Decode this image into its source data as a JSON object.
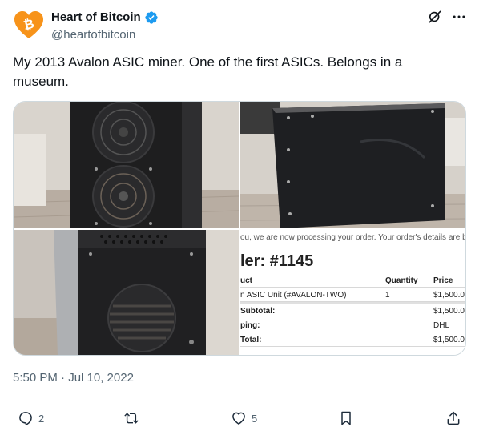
{
  "author": {
    "name": "Heart of Bitcoin",
    "handle": "@heartofbitcoin",
    "verified": true
  },
  "tweet": {
    "text": "My 2013 Avalon ASIC miner. One of the first ASICs. Belongs in a museum.",
    "timestamp": "5:50 PM · Jul 10, 2022"
  },
  "receipt": {
    "message": "ou, we are now processing your order. Your order's details are below.",
    "order_label": "ler: #1145",
    "headers": [
      "uct",
      "Quantity",
      "Price"
    ],
    "rows": [
      [
        "n ASIC Unit (#AVALON-TWO)",
        "1",
        "$1,500.0"
      ],
      [
        "Subtotal:",
        "",
        "$1,500.0"
      ],
      [
        "ping:",
        "",
        "DHL"
      ],
      [
        "Total:",
        "",
        "$1,500.0"
      ]
    ]
  },
  "engagement": {
    "replies": "2",
    "reposts": "",
    "likes": "5"
  },
  "colors": {
    "accent": "#1d9bf0",
    "avatar_orange": "#f7931a",
    "muted": "#536471"
  },
  "icons": {
    "reply": "reply-icon",
    "repost": "repost-icon",
    "like": "heart-icon",
    "bookmark": "bookmark-icon",
    "share": "share-icon",
    "grok": "grok-icon",
    "more": "more-icon"
  }
}
